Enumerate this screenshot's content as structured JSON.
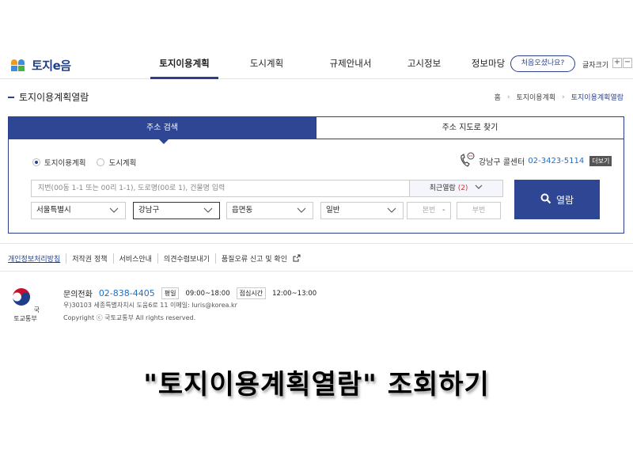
{
  "header": {
    "logo_text": "토지e음",
    "nav": [
      "토지이용계획",
      "도시계획",
      "규제안내서",
      "고시정보",
      "정보마당"
    ],
    "first_visit_label": "처음오셨나요?",
    "font_size_label": "글자크기",
    "font_plus": "+",
    "font_minus": "−"
  },
  "page": {
    "title": "토지이용계획열람",
    "breadcrumb": [
      "홈",
      "토지이용계획",
      "토지이용계획열람"
    ]
  },
  "search": {
    "tabs": [
      "주소 검색",
      "주소 지도로 찾기"
    ],
    "radios": [
      "토지이용계획",
      "도시계획"
    ],
    "selected_radio": "토지이용계획",
    "call_center_label": "강남구 콜센터",
    "call_center_number": "02-3423-5114",
    "more_label": "더보기",
    "address_placeholder": "지번(00동 1-1 또는 00리 1-1), 도로명(00로 1), 건물명 입력",
    "recent_label": "최근열람",
    "recent_count": "(2)",
    "submit_label": "열람",
    "selects": [
      "서울특별시",
      "강남구",
      "읍면동",
      "일반"
    ],
    "main_number_placeholder": "본번",
    "sub_number_placeholder": "부번",
    "dash": "-"
  },
  "footer": {
    "links": [
      "개인정보처리방침",
      "저작권 정책",
      "서비스안내",
      "의견수렴보내기",
      "품질오류 신고 및 확인"
    ],
    "ministry_name": "국토교통부",
    "contact_label": "문의전화",
    "contact_phone": "02-838-4405",
    "weekday_tag": "평일",
    "weekday_hours": "09:00~18:00",
    "lunch_tag": "점심시간",
    "lunch_hours": "12:00~13:00",
    "address": "우)30103 세종특별자치시 도움6로 11      이메일: luris@korea.kr",
    "copyright": "Copyright ⓒ 국토교통부 All rights reserved."
  },
  "caption": "\"토지이용계획열람\" 조회하기",
  "colors": {
    "primary": "#2e4694",
    "link_blue": "#1f6fc6",
    "accent_red": "#dd3333"
  },
  "icons": [
    "logo-mark-icon",
    "phone-icon",
    "search-icon",
    "chevron-down-icon",
    "external-link-icon",
    "ministry-emblem-icon"
  ]
}
